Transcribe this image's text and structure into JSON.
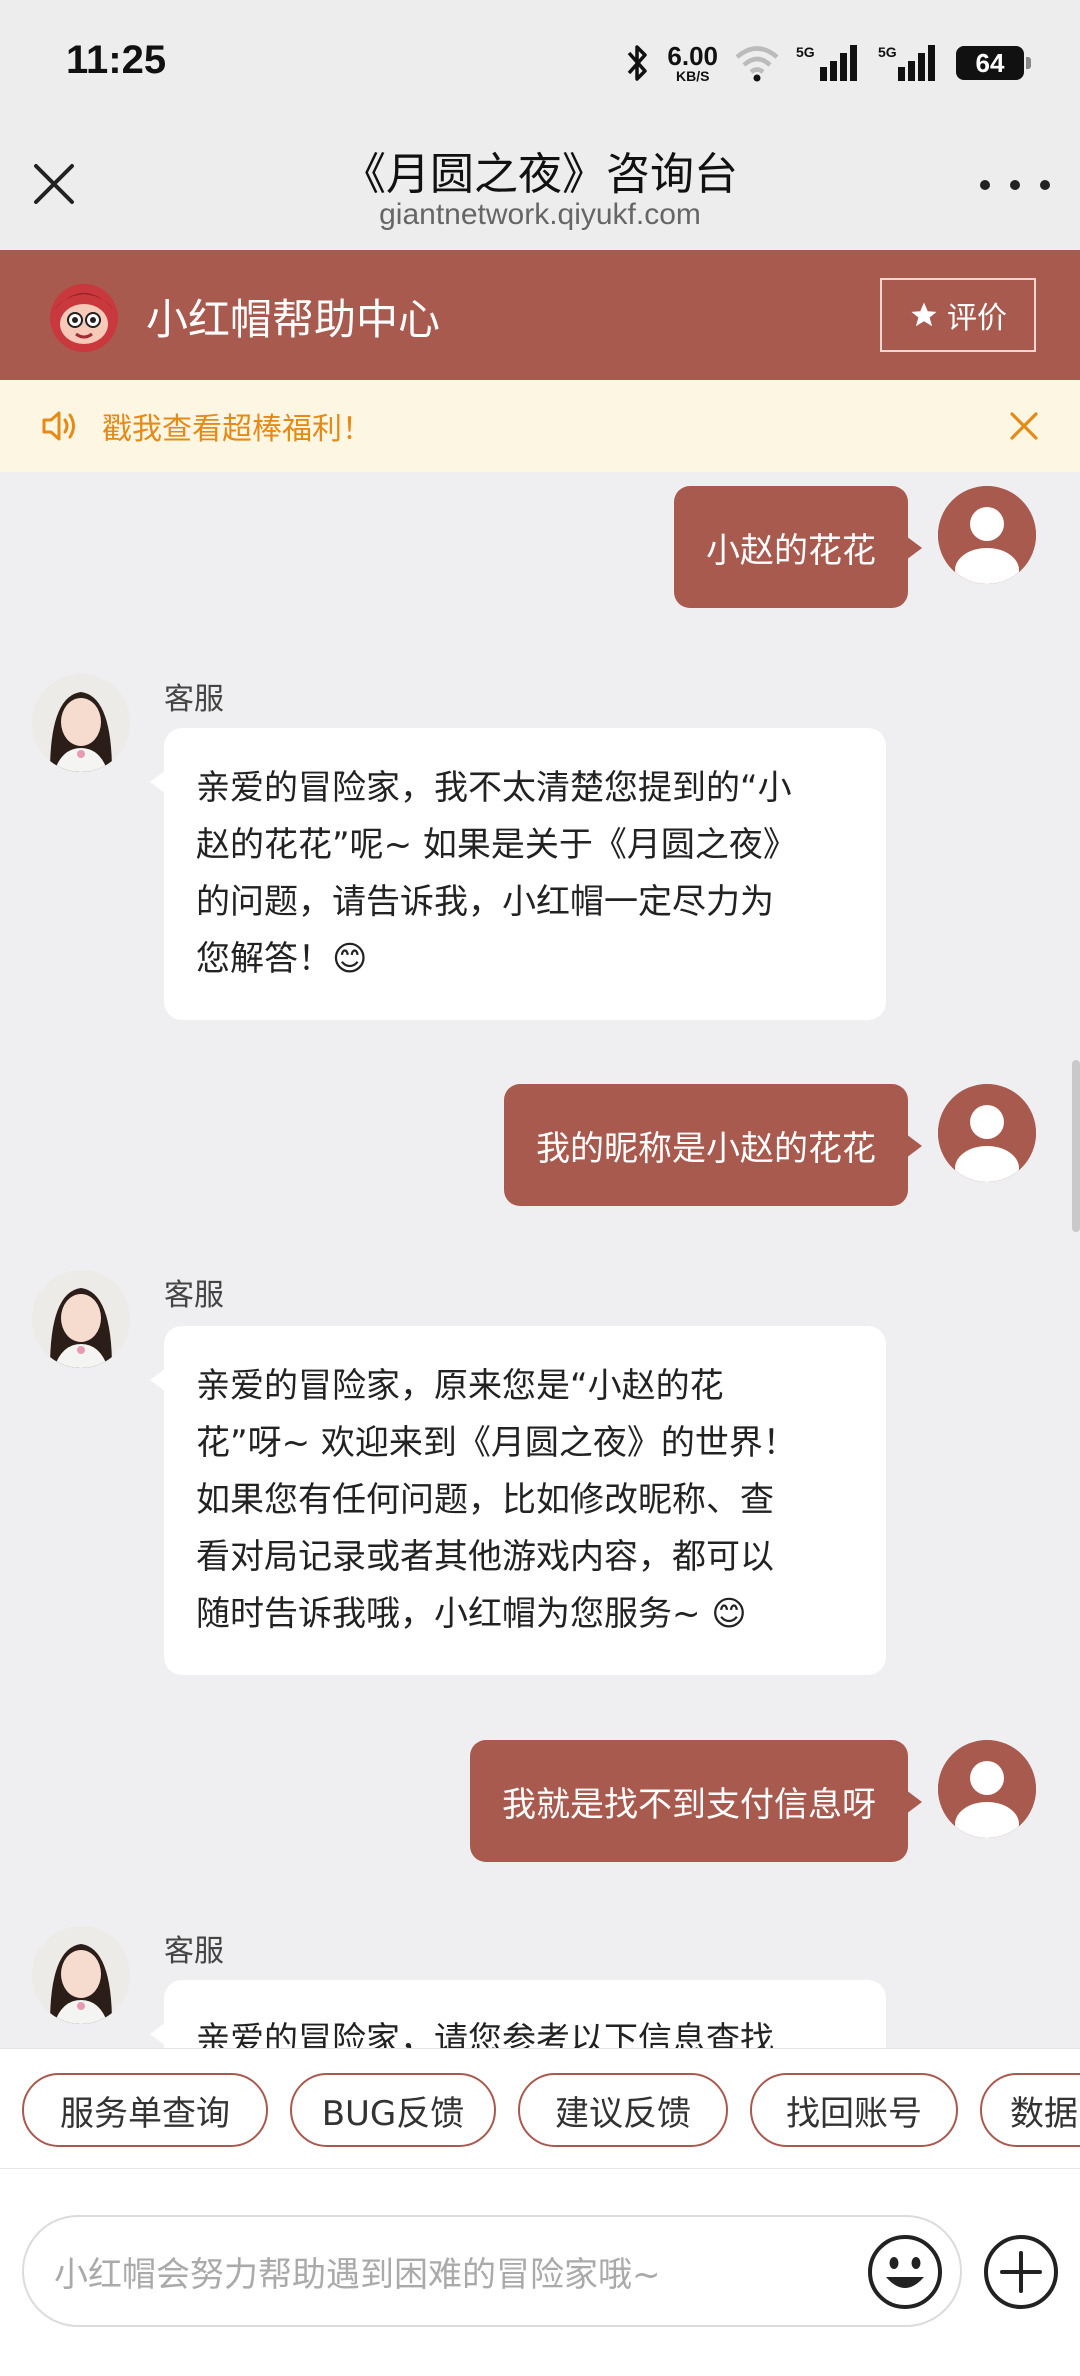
{
  "status_bar": {
    "time": "11:25",
    "speed_value": "6.00",
    "speed_unit": "KB/S",
    "signal1_label": "5G",
    "signal2_label": "5G",
    "battery": "64"
  },
  "titlebar": {
    "title": "《月圆之夜》咨询台",
    "domain": "giantnetwork.qiyukf.com"
  },
  "help_header": {
    "name": "小红帽帮助中心",
    "rate_label": "评价"
  },
  "notice": {
    "text": "戳我查看超棒福利！"
  },
  "messages": [
    {
      "from": "user",
      "text": "小赵的花花"
    },
    {
      "from": "agent",
      "label": "客服",
      "lines": [
        "亲爱的冒险家，我不太清楚您提到的“小",
        "赵的花花”呢~ 如果是关于《月圆之夜》",
        "的问题，请告诉我，小红帽一定尽力为",
        "您解答！😊"
      ]
    },
    {
      "from": "user",
      "text": "我的昵称是小赵的花花"
    },
    {
      "from": "agent",
      "label": "客服",
      "lines": [
        "亲爱的冒险家，原来您是“小赵的花",
        "花”呀~ 欢迎来到《月圆之夜》的世界！",
        "如果您有任何问题，比如修改昵称、查",
        "看对局记录或者其他游戏内容，都可以",
        "随时告诉我哦，小红帽为您服务~ 😊"
      ]
    },
    {
      "from": "user",
      "text": "我就是找不到支付信息呀"
    },
    {
      "from": "agent",
      "label": "客服",
      "lines": [
        "亲爱的冒险家，请您参考以下信息查找"
      ]
    }
  ],
  "quick_chips": [
    "服务单查询",
    "BUG反馈",
    "建议反馈",
    "找回账号",
    "数据"
  ],
  "input": {
    "placeholder": "小红帽会努力帮助遇到困难的冒险家哦~"
  },
  "colors": {
    "brand": "#a85a4f",
    "notice_text": "#e58a17",
    "notice_bg": "#fdf6e3"
  }
}
